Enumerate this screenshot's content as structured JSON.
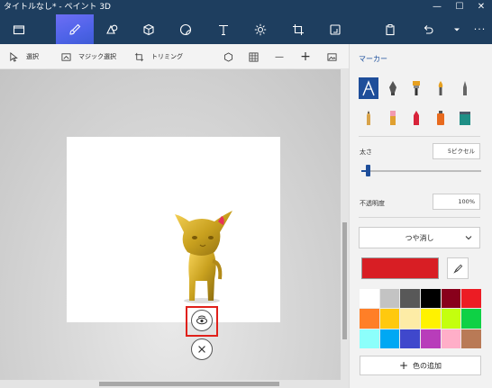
{
  "window": {
    "title": "タイトルなし* - ペイント 3D",
    "minimize": "—",
    "maximize": "☐",
    "close": "✕"
  },
  "toolbar": {
    "tools": [
      {
        "name": "menu-tool",
        "icon": "folder-icon"
      },
      {
        "name": "brushes-tool",
        "icon": "brush-icon",
        "active": true
      },
      {
        "name": "2d-shapes-tool",
        "icon": "2d-shapes-icon"
      },
      {
        "name": "3d-shapes-tool",
        "icon": "cube-icon"
      },
      {
        "name": "stickers-tool",
        "icon": "sticker-icon"
      },
      {
        "name": "text-tool",
        "icon": "text-icon"
      },
      {
        "name": "effects-tool",
        "icon": "sun-icon"
      },
      {
        "name": "canvas-tool",
        "icon": "canvas-crop-icon"
      },
      {
        "name": "remix3d-tool",
        "icon": "remix-icon"
      }
    ],
    "right": [
      "paste-icon",
      "undo-icon",
      "history-chevron-icon",
      "more-icon"
    ],
    "more_label": "···"
  },
  "subbar": {
    "select": "選択",
    "magic_select": "マジック選択",
    "crop": "トリミング",
    "zoom_out": "—",
    "zoom_in": "+"
  },
  "panel": {
    "heading": "マーカー",
    "thickness_label": "太さ",
    "thickness_value": "5ピクセル",
    "thickness_level": 0.05,
    "opacity_label": "不透明度",
    "opacity_value": "100%",
    "finish": "つや消し",
    "current_color": "#d81e24",
    "add_color": "色の追加",
    "add_color_plus": "+",
    "palette": [
      "#ffffff",
      "#c3c3c3",
      "#585858",
      "#000000",
      "#88001b",
      "#ec1c24",
      "#ff7f27",
      "#ffc90e",
      "#fdeca6",
      "#fff200",
      "#c4ff0e",
      "#0ed145",
      "#8cfffb",
      "#00a8f3",
      "#3f48cc",
      "#b83dba",
      "#ffaec8",
      "#b97a56"
    ]
  }
}
